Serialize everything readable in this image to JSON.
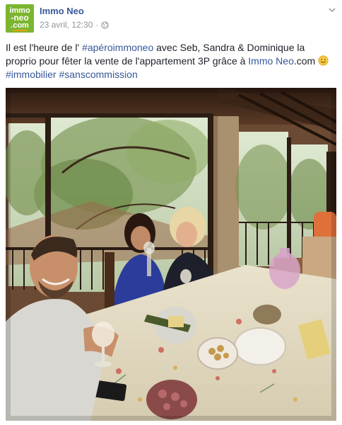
{
  "post": {
    "page_name": "Immo Neo",
    "avatar_logo": {
      "line1": "immo",
      "line2": "-neo",
      "line3": ".com"
    },
    "timestamp": "23 avril, 12:30",
    "separator": "·",
    "privacy_icon": "globe-icon",
    "menu_icon": "chevron-down-icon",
    "message": {
      "part1": "Il est l'heure de l' ",
      "hashtag1": "#apéroimmoneo",
      "part2": " avec Seb, Sandra & Dominique la proprio pour fêter la vente de l'appartement 3P grâce à ",
      "mention": "Immo Neo",
      "part3": ".com ",
      "emoji": "smile-emoji-icon",
      "hashtag2": "#immobilier",
      "space": " ",
      "hashtag3": "#sanscommission"
    },
    "photo": {
      "description_icon": "group-selfie-photo"
    }
  },
  "colors": {
    "link": "#365899",
    "text": "#1d2129",
    "meta": "#90949c",
    "brand_green": "#7cb62f"
  }
}
